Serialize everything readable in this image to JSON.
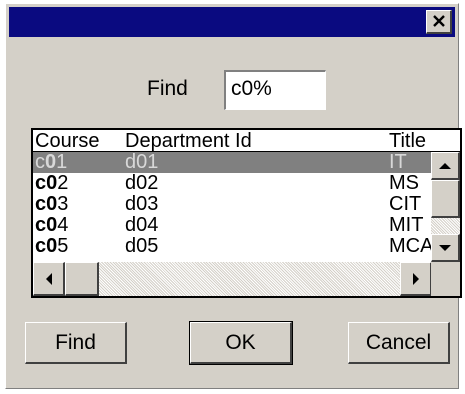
{
  "dialog": {
    "title": "",
    "find_label": "Find",
    "find_value": "c0%"
  },
  "grid": {
    "columns": [
      "Course",
      "Department Id",
      "Title"
    ],
    "rows": [
      {
        "course_prefix": "c",
        "course_bold": "0",
        "course_rest": "1",
        "department_id": "d01",
        "title": "IT",
        "selected": true
      },
      {
        "course_prefix": "c",
        "course_bold": "0",
        "course_rest": "2",
        "department_id": "d02",
        "title": "MS",
        "selected": false
      },
      {
        "course_prefix": "c",
        "course_bold": "0",
        "course_rest": "3",
        "department_id": "d03",
        "title": "CIT",
        "selected": false
      },
      {
        "course_prefix": "c",
        "course_bold": "0",
        "course_rest": "4",
        "department_id": "d04",
        "title": "MIT",
        "selected": false
      },
      {
        "course_prefix": "c",
        "course_bold": "0",
        "course_rest": "5",
        "department_id": "d05",
        "title": "MCA",
        "selected": false
      }
    ]
  },
  "buttons": {
    "find": "Find",
    "ok": "OK",
    "cancel": "Cancel"
  },
  "icons": {
    "close": "close-icon",
    "scroll_up": "arrow-up-icon",
    "scroll_down": "arrow-down-icon",
    "scroll_left": "arrow-left-icon",
    "scroll_right": "arrow-right-icon"
  },
  "colors": {
    "titlebar": "#0a0a80",
    "dialog_bg": "#d4d0c8",
    "selected_row": "#808080"
  }
}
